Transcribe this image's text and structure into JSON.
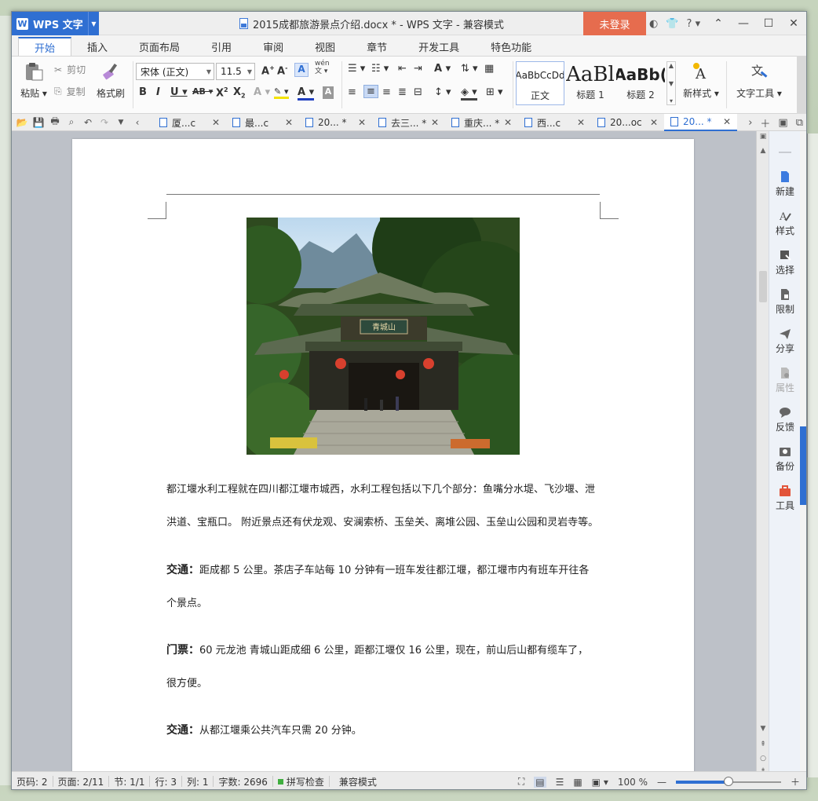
{
  "title_bar": {
    "app_button": "WPS 文字",
    "document_title": "2015成都旅游景点介绍.docx * - WPS 文字 - 兼容模式",
    "login_button": "未登录",
    "help_label": "?"
  },
  "ribbon_tabs": [
    {
      "label": "开始",
      "active": true
    },
    {
      "label": "插入",
      "active": false
    },
    {
      "label": "页面布局",
      "active": false
    },
    {
      "label": "引用",
      "active": false
    },
    {
      "label": "审阅",
      "active": false
    },
    {
      "label": "视图",
      "active": false
    },
    {
      "label": "章节",
      "active": false
    },
    {
      "label": "开发工具",
      "active": false
    },
    {
      "label": "特色功能",
      "active": false
    }
  ],
  "ribbon": {
    "paste_label": "粘贴",
    "cut_label": "剪切",
    "copy_label": "复制",
    "format_painter_label": "格式刷",
    "font_name": "宋体 (正文)",
    "font_size": "11.5",
    "pinyin_label": "wén",
    "styles": [
      {
        "preview": "AaBbCcDd",
        "name": "正文"
      },
      {
        "preview": "AaBl",
        "name": "标题 1"
      },
      {
        "preview": "AaBb(",
        "name": "标题 2"
      }
    ],
    "new_style_label": "新样式",
    "text_tools_label": "文字工具"
  },
  "doc_tabs": [
    {
      "label": "厦...c",
      "active": false
    },
    {
      "label": "最...c",
      "active": false
    },
    {
      "label": "20... *",
      "active": false
    },
    {
      "label": "去三... *",
      "active": false
    },
    {
      "label": "重庆... *",
      "active": false
    },
    {
      "label": "西...c",
      "active": false
    },
    {
      "label": "20...oc",
      "active": false
    },
    {
      "label": "20... *",
      "active": true
    }
  ],
  "document": {
    "paragraph1_line1": "都江堰水利工程就在四川都江堰市城西，水利工程包括以下几个部分：鱼嘴分水堤、飞沙堰、泄",
    "paragraph1_line2": "洪道、宝瓶口。 附近景点还有伏龙观、安澜索桥、玉垒关、离堆公园、玉垒山公园和灵岩寺等。",
    "p2_label": "交通：",
    "p2_line1": "距成都 5 公里。茶店子车站每 10 分钟有一班车发往都江堰，都江堰市内有班车开往各",
    "p2_line2": "个景点。",
    "p3_label": "门票：",
    "p3_line1": "60 元龙池  青城山距成细 6 公里，距都江堰仅 16 公里，现在，前山后山都有缆车了，",
    "p3_line2": "很方便。",
    "p4_label": "交通：",
    "p4_line1": "从都江堰乘公共汽车只需 20 分钟。",
    "photo_sign": "青城山"
  },
  "side_panel": [
    {
      "label": "新建",
      "icon": "new-doc-icon"
    },
    {
      "label": "样式",
      "icon": "style-icon"
    },
    {
      "label": "选择",
      "icon": "select-icon"
    },
    {
      "label": "限制",
      "icon": "restrict-icon"
    },
    {
      "label": "分享",
      "icon": "share-icon"
    },
    {
      "label": "属性",
      "icon": "properties-icon"
    },
    {
      "label": "反馈",
      "icon": "feedback-icon"
    },
    {
      "label": "备份",
      "icon": "backup-icon"
    },
    {
      "label": "工具",
      "icon": "toolbox-icon"
    }
  ],
  "status_bar": {
    "page_num": "页码: 2",
    "pages": "页面: 2/11",
    "section": "节: 1/1",
    "row": "行: 3",
    "col": "列: 1",
    "word_count": "字数: 2696",
    "spell_check": "拼写检查",
    "compat_mode": "兼容模式",
    "zoom": "100 %",
    "zoom_fraction": 0.5
  },
  "colors": {
    "accent": "#2f6fd2",
    "login": "#e66c4e"
  }
}
